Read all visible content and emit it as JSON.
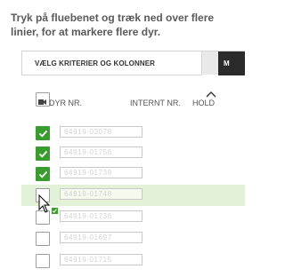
{
  "instruction": "Tryk på fluebenet og træk ned over flere linier, for at markere flere dyr.",
  "tabs": {
    "active_label": "VÆLG KRITERIER OG KOLONNER",
    "dark_label": "M"
  },
  "columns": {
    "animal_nr": "DYR NR.",
    "internal_nr": "INTERNT NR.",
    "hold": "HOLD"
  },
  "icons": {
    "camera": "camera-icon",
    "sort": "sort-caret-up-icon",
    "cursor": "mouse-pointer-icon",
    "check": "checkmark-icon"
  },
  "colors": {
    "check_green": "#3a9b2f",
    "row_highlight": "#e3f1d8",
    "dark_tab": "#2b2b2b"
  },
  "rows": [
    {
      "checked": true,
      "value": "64919-03078"
    },
    {
      "checked": true,
      "value": "64919-01756"
    },
    {
      "checked": true,
      "value": "64919-01738"
    },
    {
      "checked": false,
      "value": "64919-01748",
      "highlighted": true
    },
    {
      "checked": false,
      "value": "64919-01736"
    },
    {
      "checked": false,
      "value": "64919-01697"
    },
    {
      "checked": false,
      "value": "64919-01715"
    }
  ]
}
